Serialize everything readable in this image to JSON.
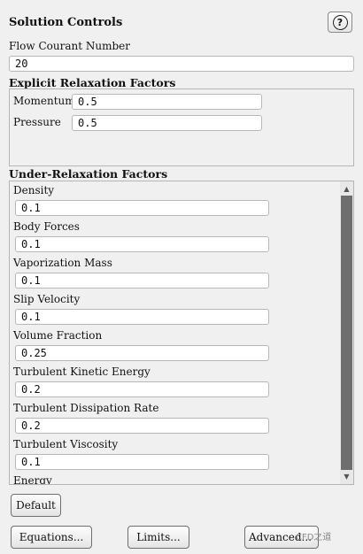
{
  "panel": {
    "title": "Solution Controls",
    "help_label": "?"
  },
  "flow_courant": {
    "label": "Flow Courant Number",
    "value": "20"
  },
  "explicit": {
    "title": "Explicit Relaxation Factors",
    "momentum_label": "Momentum",
    "momentum_value": "0.5",
    "pressure_label": "Pressure",
    "pressure_value": "0.5"
  },
  "under_relaxation": {
    "title": "Under-Relaxation Factors",
    "items": [
      {
        "label": "Density",
        "value": "0.1"
      },
      {
        "label": "Body Forces",
        "value": "0.1"
      },
      {
        "label": "Vaporization Mass",
        "value": "0.1"
      },
      {
        "label": "Slip Velocity",
        "value": "0.1"
      },
      {
        "label": "Volume Fraction",
        "value": "0.25"
      },
      {
        "label": "Turbulent Kinetic Energy",
        "value": "0.2"
      },
      {
        "label": "Turbulent Dissipation Rate",
        "value": "0.2"
      },
      {
        "label": "Turbulent Viscosity",
        "value": "0.1"
      },
      {
        "label": "Energy",
        "value": ""
      }
    ]
  },
  "buttons": {
    "default": "Default",
    "equations": "Equations...",
    "limits": "Limits...",
    "advanced": "Advanced..."
  },
  "watermark": "CFD之道"
}
